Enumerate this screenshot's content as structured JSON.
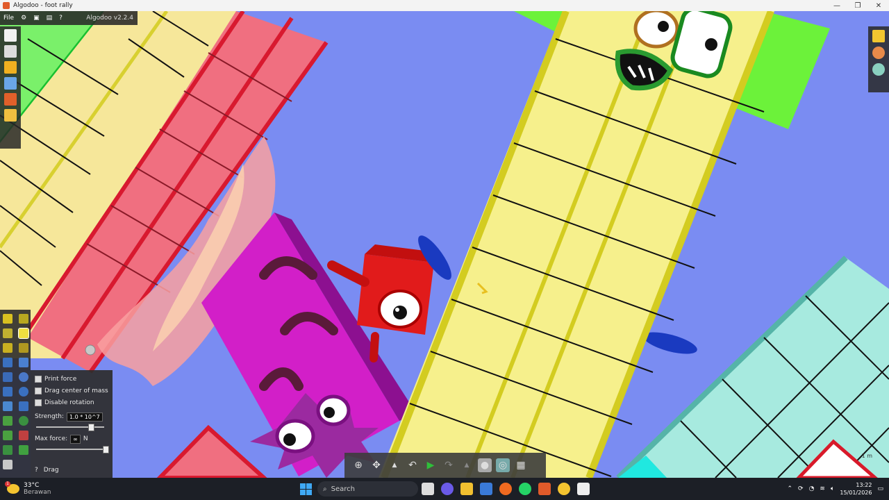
{
  "window": {
    "title": "Algodoo - foot rally",
    "minimize": "—",
    "maximize": "❐",
    "close": "✕"
  },
  "menubar": {
    "file": "File",
    "help": "?",
    "version": "Algodoo v2.2.4"
  },
  "options_panel": {
    "print_force": "Print force",
    "drag_center_of_mass": "Drag center of mass",
    "disable_rotation": "Disable rotation",
    "strength_label": "Strength:",
    "strength_value": "1.0 * 10^7",
    "strength_level": 0.8,
    "max_force_label": "Max force:",
    "max_force_value": "∞",
    "max_force_unit": "N",
    "max_force_level": 1.0,
    "tool_help": "?",
    "tool_name": "Drag"
  },
  "scale_label": "1 m",
  "taskbar": {
    "weather_temp": "33°C",
    "weather_desc": "Berawan",
    "weather_badge": "1",
    "search_placeholder": "Search",
    "time": "13:22",
    "date": "15/01/2026"
  },
  "colors": {
    "background": "#7a8cf2",
    "yellow_block": "#f6f08c",
    "red_block": "#f26f7c",
    "magenta_block": "#d21fc8",
    "teal_block": "#a7eadf",
    "green_block": "#6cf23a",
    "taskbar": "#1c1f26"
  }
}
